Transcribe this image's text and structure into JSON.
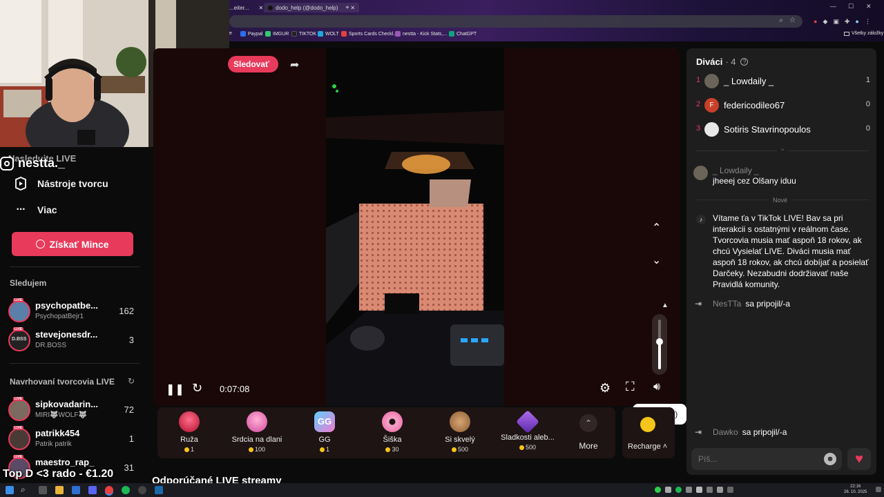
{
  "browser": {
    "tabs": [
      {
        "label": "...eiter...",
        "has_close": true
      },
      {
        "label": "dodo_help (@dodo_help)",
        "has_close": true
      }
    ],
    "new_tab_label": "+",
    "bookmarks": [
      {
        "label": "e",
        "color": "#7a7a7a"
      },
      {
        "label": "Paypal",
        "color": "#2a6ff0"
      },
      {
        "label": "IMGUR",
        "color": "#2ecc71"
      },
      {
        "label": "TIKTOK",
        "color": "#222222"
      },
      {
        "label": "WOLT",
        "color": "#1ea7e1"
      },
      {
        "label": "Sports Cards Checkl...",
        "color": "#e84040"
      },
      {
        "label": "nestta - Kick Stats,...",
        "color": "#9b59b6"
      },
      {
        "label": "ChatGPT",
        "color": "#10a37f"
      }
    ],
    "all_bookmarks_label": "Všetky záložky"
  },
  "sidebar": {
    "obscured_item_label": "Nasledujte LIVE",
    "username": "nestta._",
    "items": [
      {
        "label": "Nástroje tvorcu",
        "icon": "play-square-icon"
      },
      {
        "label": "Viac",
        "icon": "more-dots-icon"
      }
    ],
    "coins_button": "Získať Mince",
    "following_title": "Sledujem",
    "following": [
      {
        "name": "psychopatbe...",
        "sub": "PsychopatBejr1",
        "count": "162",
        "live": "LIVE"
      },
      {
        "name": "stevejonesdr...",
        "sub": "DR.BOSS",
        "count": "3",
        "live": "LIVE"
      }
    ],
    "suggested_title": "Navrhovaní tvorcovia LIVE",
    "suggested": [
      {
        "name": "sipkovadarin...",
        "sub": "MIRI🐺WOLF🐺",
        "count": "72",
        "live": "LIVE"
      },
      {
        "name": "patrikk454",
        "sub": "Patrik patrik",
        "count": "1",
        "live": "LIVE"
      },
      {
        "name": "maestro_rap_",
        "sub": "",
        "count": "31",
        "live": "LIVE"
      }
    ]
  },
  "overlay": {
    "top_donation": "Top D <3 rado - €1.20"
  },
  "player": {
    "follow_button": "Sledovať",
    "time": "0:07:08",
    "tooltip": "Stlmiť (M)",
    "volume_level": 0.55
  },
  "gifts": [
    {
      "name": "Ruža",
      "price": "1",
      "color": "#e0284f"
    },
    {
      "name": "Srdcia na dlani",
      "price": "100",
      "color": "#e866b4"
    },
    {
      "name": "GG",
      "price": "1",
      "color": "#59d0ff"
    },
    {
      "name": "Šiška",
      "price": "30",
      "color": "#f28fc2"
    },
    {
      "name": "Si skvelý",
      "price": "500",
      "color": "#c8915a"
    },
    {
      "name": "Sladkosti aleb...",
      "price": "500",
      "color": "#8a4bd8"
    }
  ],
  "gift_more_label": "More",
  "recharge_label": "Recharge",
  "main": {
    "recommended_heading": "Odporúčané LIVE streamy"
  },
  "chat": {
    "viewers_title": "Diváci",
    "viewers_count": "· 4",
    "viewers": [
      {
        "rank": "1",
        "name": "_ Lowdaily _",
        "count": "1",
        "avatar_color": "#6b6458"
      },
      {
        "rank": "2",
        "name": "federicodileo67",
        "count": "0",
        "avatar_color": "#c8402a",
        "initial": "F"
      },
      {
        "rank": "3",
        "name": "Sotiris Stavrinopoulos",
        "count": "0",
        "avatar_color": "#e8e8e8"
      }
    ],
    "messages": [
      {
        "user": "_ Lowdaily _",
        "text": "jheeej cez Olšany iduu"
      }
    ],
    "new_label": "Nové",
    "welcome": "Vítame ťa v TikTok LIVE! Bav sa pri interakcii s ostatnými v reálnom čase. Tvorcovia musia mať aspoň 18 rokov, ak chcú Vysielať LIVE. Diváci musia mať aspoň 18 rokov, ak chcú dobíjať a posielať Darčeky. Nezabudni dodržiavať naše Pravidlá komunity.",
    "joins": [
      {
        "user": "NesTTa",
        "text": "sa pripojil/-a"
      },
      {
        "user": "Dawko",
        "text": "sa pripojil/-a"
      }
    ],
    "input_placeholder": "Píš..."
  },
  "taskbar": {
    "time": "22:16",
    "date": "26. 10. 2025"
  }
}
